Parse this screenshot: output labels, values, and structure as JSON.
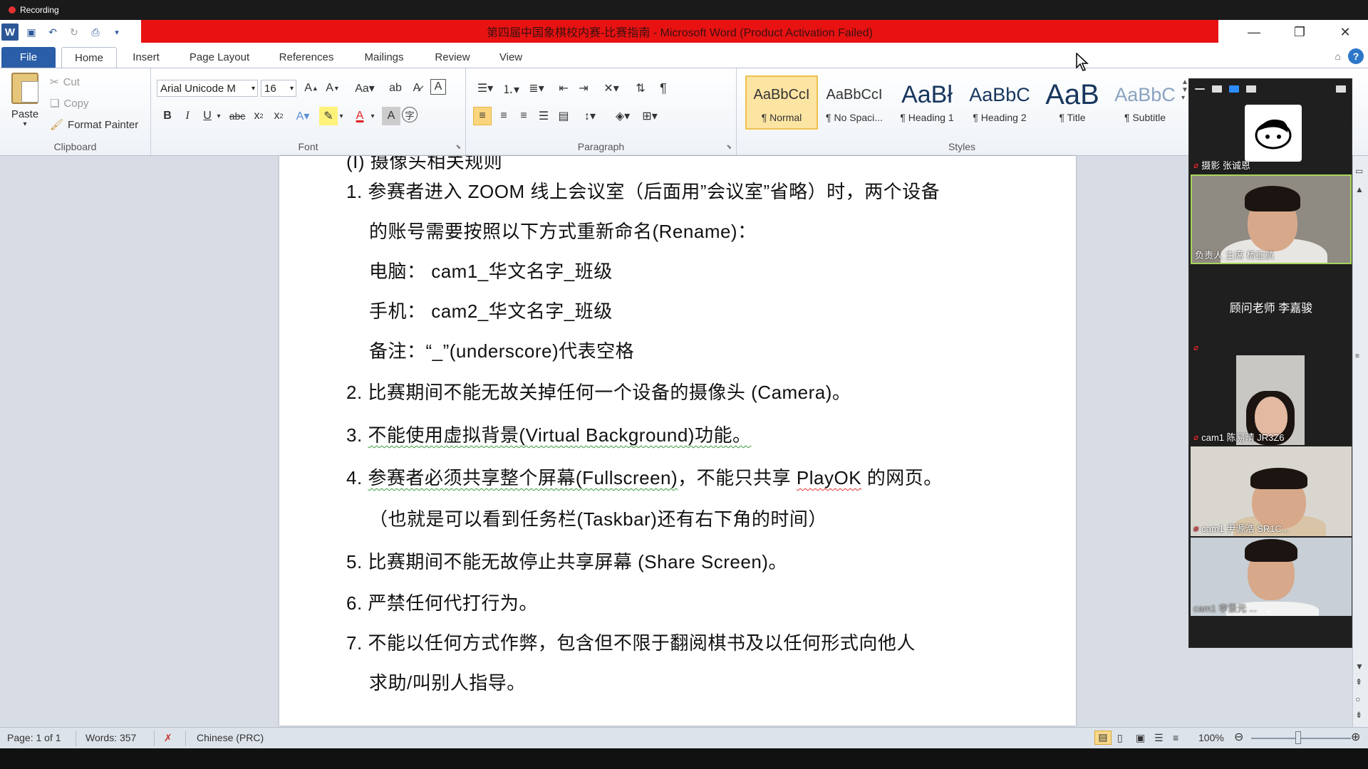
{
  "recording": {
    "label": "Recording"
  },
  "window": {
    "title": "第四届中国象棋校内赛-比赛指南 - Microsoft Word (Product Activation Failed)"
  },
  "tabs": [
    "File",
    "Home",
    "Insert",
    "Page Layout",
    "References",
    "Mailings",
    "Review",
    "View"
  ],
  "clipboard": {
    "paste": "Paste",
    "cut": "Cut",
    "copy": "Copy",
    "format_painter": "Format Painter",
    "label": "Clipboard"
  },
  "font": {
    "name": "Arial Unicode M",
    "size": "16",
    "label": "Font"
  },
  "paragraph": {
    "label": "Paragraph"
  },
  "styles": {
    "label": "Styles",
    "items": [
      {
        "preview": "AaBbCcI",
        "name": "¶ Normal"
      },
      {
        "preview": "AaBbCcI",
        "name": "¶ No Spaci..."
      },
      {
        "preview": "AaBł",
        "name": "¶ Heading 1"
      },
      {
        "preview": "AaBbC",
        "name": "¶ Heading 2"
      },
      {
        "preview": "AaB",
        "name": "¶ Title"
      },
      {
        "preview": "AaBbC",
        "name": "¶ Subtitle"
      }
    ]
  },
  "document": {
    "heading": "(I) 摄像头相关规则",
    "item1_a": "1. 参赛者进入 ZOOM 线上会议室（后面用”会议室”省略）时，两个设备",
    "item1_b": "的账号需要按照以下方式重新命名(Rename)：",
    "item1_c": "电脑： cam1_华文名字_班级",
    "item1_d": "手机： cam2_华文名字_班级",
    "item1_e": "备注：“_”(underscore)代表空格",
    "item2": "2. 比赛期间不能无故关掉任何一个设备的摄像头 (Camera)。",
    "item3_num": "3. ",
    "item3": "不能使用虚拟背景(Virtual Background)功能。",
    "item4_num": "4. ",
    "item4_a": "参赛者必须共享整个屏幕(Fullscreen)",
    "item4_b": "，不能只共享 ",
    "item4_c": "PlayOK",
    "item4_d": " 的网页。",
    "item4_e": "（也就是可以看到任务栏(Taskbar)还有右下角的时间）",
    "item5": "5. 比赛期间不能无故停止共享屏幕 (Share Screen)。",
    "item6": "6. 严禁任何代打行为。",
    "item7_a": "7. 不能以任何方式作弊，包含但不限于翻阅棋书及以任何形式向他人",
    "item7_b": "求助/叫别人指导。"
  },
  "status": {
    "page": "Page: 1 of 1",
    "words": "Words: 357",
    "language": "Chinese (PRC)",
    "zoom": "100%"
  },
  "zoom_participants": [
    {
      "name": "摄影 张诚恩"
    },
    {
      "name": "负责人 主席 杨征航"
    },
    {
      "name": "顾问老师 李嘉骏"
    },
    {
      "name": "cam1 陈易晴 JR3Z6"
    },
    {
      "name": "cam1 尹源浩 SR1C..."
    },
    {
      "name": "cam1 李景元 ..."
    }
  ],
  "colors": {
    "title_bar": "#e81212",
    "file_tab": "#2a5ea8",
    "zoom_bg": "#1f1f1f"
  }
}
